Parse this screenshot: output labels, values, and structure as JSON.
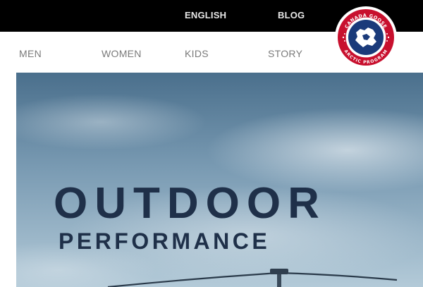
{
  "topbar": {
    "language_label": "ENGLISH",
    "blog_label": "BLOG"
  },
  "nav": {
    "items": [
      {
        "label": "MEN"
      },
      {
        "label": "WOMEN"
      },
      {
        "label": "KIDS"
      },
      {
        "label": "STORY"
      }
    ]
  },
  "logo": {
    "ring_text_top": "CANADA GOOSE",
    "ring_text_bottom": "ARCTIC PROGRAM",
    "colors": {
      "ring": "#c8102e",
      "inner": "#1a3a7a",
      "map": "#ffffff"
    }
  },
  "hero": {
    "headline": "OUTDOOR",
    "subheadline": "PERFORMANCE",
    "colors": {
      "text": "#1f3049",
      "sky_top": "#4f7490",
      "sky_bottom": "#a9c3d2"
    }
  }
}
